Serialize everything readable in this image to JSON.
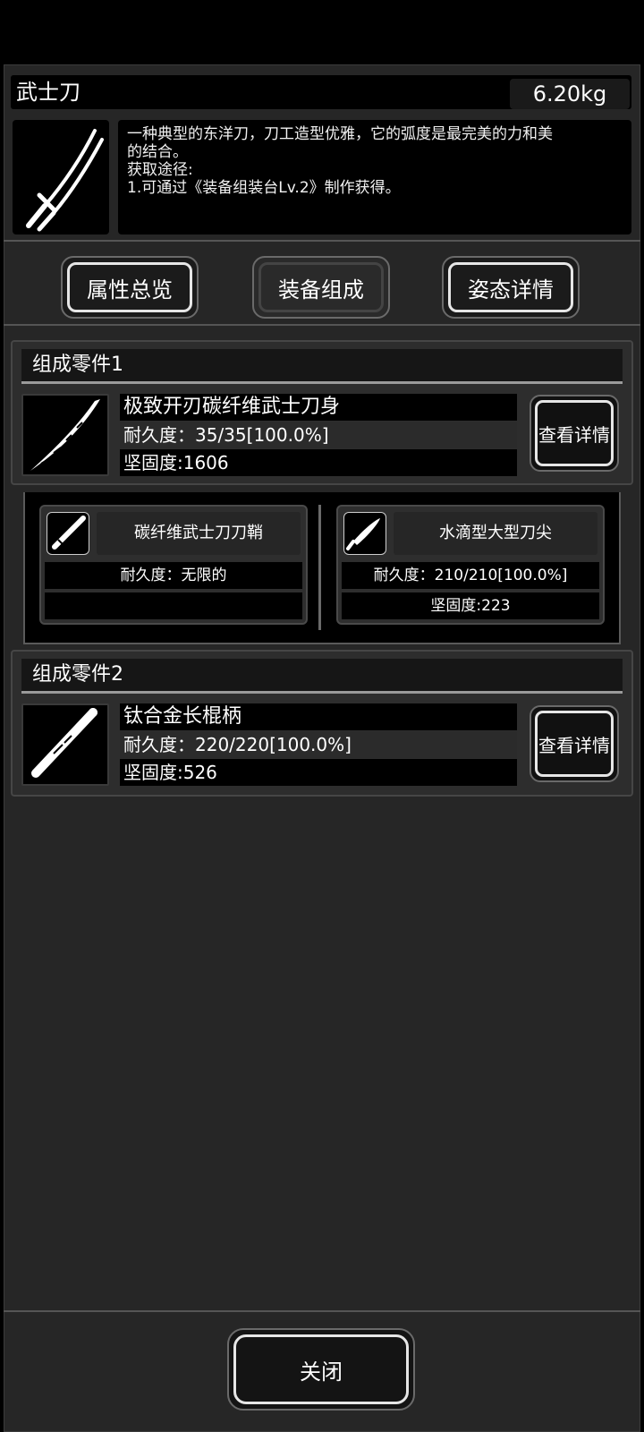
{
  "item": {
    "name": "武士刀",
    "weight": "6.20kg",
    "icon": "katana-icon",
    "description": [
      "一种典型的东洋刀，刀工造型优雅，它的弧度是最完美的力和美",
      "的结合。",
      "获取途径:",
      "1.可通过《装备组装台Lv.2》制作获得。"
    ]
  },
  "tabs": {
    "overview": "属性总览",
    "composition": "装备组成",
    "stance": "姿态详情"
  },
  "parts": [
    {
      "header": "组成零件1",
      "name": "极致开刃碳纤维武士刀身",
      "durability": "耐久度：35/35[100.0%]",
      "toughness": "坚固度:1606",
      "detail_label": "查看详情",
      "icon": "blade-icon"
    },
    {
      "header": "组成零件2",
      "name": "钛合金长棍柄",
      "durability": "耐久度：220/220[100.0%]",
      "toughness": "坚固度:526",
      "detail_label": "查看详情",
      "icon": "handle-icon"
    }
  ],
  "subparts": [
    {
      "name": "碳纤维武士刀刀鞘",
      "durability": "耐久度：无限的",
      "toughness": "",
      "icon": "scabbard-icon"
    },
    {
      "name": "水滴型大型刀尖",
      "durability": "耐久度：210/210[100.0%]",
      "toughness": "坚固度:223",
      "icon": "blade-tip-icon"
    }
  ],
  "close_label": "关闭",
  "colors": {
    "panel": "#262626",
    "card": "#2d2d2d",
    "accent_border": "#e6e6e6"
  }
}
